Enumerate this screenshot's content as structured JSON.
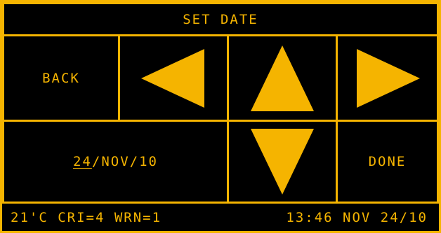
{
  "header": {
    "title": "SET DATE"
  },
  "controls": {
    "back_label": "BACK",
    "done_label": "DONE"
  },
  "date_field": {
    "day": "24",
    "separator1": "/",
    "month": "NOV",
    "separator2": "/",
    "year": "10"
  },
  "status_bar": {
    "left": "21'C CRI=4 WRN=1",
    "right": "13:46 NOV 24/10"
  },
  "icons": {
    "left": "arrow-left-icon",
    "up": "arrow-up-icon",
    "right": "arrow-right-icon",
    "down": "arrow-down-icon"
  },
  "colors": {
    "accent": "#f5b400",
    "background": "#000000"
  }
}
